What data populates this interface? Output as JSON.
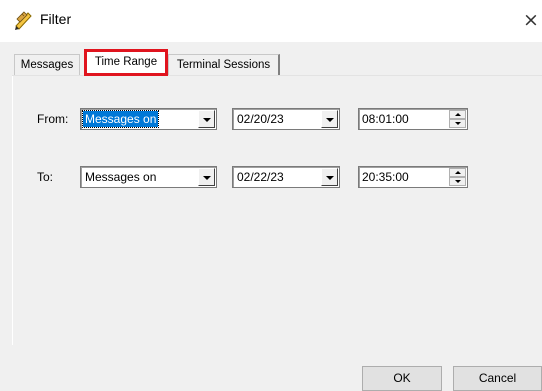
{
  "window": {
    "title": "Filter",
    "close_symbol": "×",
    "icon": "pencil-ruler-icon"
  },
  "tabs": [
    {
      "label": "Messages",
      "active": false
    },
    {
      "label": "Time Range",
      "active": true,
      "highlighted": true
    },
    {
      "label": "Terminal Sessions",
      "active": false
    }
  ],
  "time_range": {
    "from": {
      "label": "From:",
      "kind": "Messages on",
      "kind_selected": true,
      "date": "02/20/23",
      "time": "08:01:00"
    },
    "to": {
      "label": "To:",
      "kind": "Messages on",
      "kind_selected": false,
      "date": "02/22/23",
      "time": "20:35:00"
    }
  },
  "buttons": {
    "ok": "OK",
    "cancel": "Cancel"
  },
  "colors": {
    "highlight_border": "#e0141e",
    "selection": "#0078d7",
    "dialog_bg": "#f0f0f0"
  }
}
